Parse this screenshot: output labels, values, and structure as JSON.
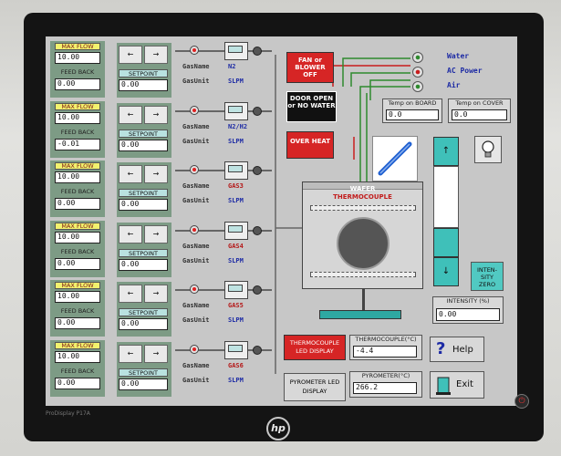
{
  "monitor": {
    "model": "ProDisplay P17A",
    "brand": "hp",
    "power_glyph": "⏻"
  },
  "common": {
    "max_flow_label": "MAX FLOW",
    "feed_back_label": "FEED BACK",
    "setpoint_label": "SETPOINT",
    "gas_name_label": "GasName",
    "gas_unit_label": "GasUnit",
    "arrow_left": "←",
    "arrow_right": "→"
  },
  "channels": [
    {
      "max_flow": "10.00",
      "feed_back": "0.00",
      "setpoint": "0.00",
      "gas_name": "N2",
      "gas_unit": "SLPM",
      "name_color": "#1c2aa4"
    },
    {
      "max_flow": "10.00",
      "feed_back": "-0.01",
      "setpoint": "0.00",
      "gas_name": "N2/H2",
      "gas_unit": "SLPM",
      "name_color": "#1c2aa4"
    },
    {
      "max_flow": "10.00",
      "feed_back": "0.00",
      "setpoint": "0.00",
      "gas_name": "GAS3",
      "gas_unit": "SLPM",
      "name_color": "#b51a1a"
    },
    {
      "max_flow": "10.00",
      "feed_back": "0.00",
      "setpoint": "0.00",
      "gas_name": "GAS4",
      "gas_unit": "SLPM",
      "name_color": "#b51a1a"
    },
    {
      "max_flow": "10.00",
      "feed_back": "0.00",
      "setpoint": "0.00",
      "gas_name": "GAS5",
      "gas_unit": "SLPM",
      "name_color": "#b51a1a"
    },
    {
      "max_flow": "10.00",
      "feed_back": "0.00",
      "setpoint": "0.00",
      "gas_name": "GAS6",
      "gas_unit": "SLPM",
      "name_color": "#b51a1a"
    }
  ],
  "alarms": {
    "fan": "FAN or BLOWER OFF",
    "door": "DOOR OPEN or NO WATER",
    "heat": "OVER HEAT"
  },
  "status": {
    "water": "Water",
    "ac_power": "AC Power",
    "air": "Air"
  },
  "temps": {
    "board_label": "Temp on BOARD",
    "board_value": "0.0",
    "cover_label": "Temp on COVER",
    "cover_value": "0.0"
  },
  "chamber": {
    "wafer_label": "WAFER",
    "thermocouple_label": "THERMOCOUPLE"
  },
  "intensity": {
    "up_arrow": "↑",
    "down_arrow": "↓",
    "zero_label": "INTEN-SITY ZERO",
    "label": "INTENSITY (%)",
    "value": "0.00",
    "level": 0.0
  },
  "thermocouple": {
    "led_button": "THERMOCOUPLE LED DISPLAY",
    "label": "THERMOCOUPLE(°C)",
    "value": "-4.4"
  },
  "pyrometer": {
    "led_button": "PYROMETER LED DISPLAY",
    "label": "PYROMETER(°C)",
    "value": "266.2"
  },
  "help": {
    "label": "Help",
    "glyph": "?"
  },
  "exit": {
    "label": "Exit"
  },
  "colors": {
    "water": "#2e8a2e",
    "ac_power": "#c81d1d",
    "air": "#2e8a2e",
    "led_red": "#e02020"
  }
}
